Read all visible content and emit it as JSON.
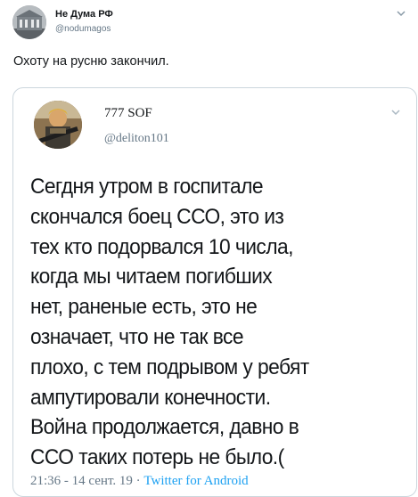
{
  "tweet": {
    "author_name": "Не Дума РФ",
    "author_handle": "@nodumagos",
    "text": "Охоту на русню закончил."
  },
  "quoted_tweet": {
    "author_name": "777 SOF",
    "author_handle": "@deliton101",
    "text_lines": [
      "Сегдня утром в госпитале",
      "скончался боец ССО, это из",
      "тех кто подорвался 10 числа,",
      "когда мы читаем погибших",
      "нет, раненые есть, это не",
      "означает, что не так все",
      "плохо, с тем подрывом у ребят",
      "ампутировали конечности.",
      "Война продолжается, давно в",
      "ССО таких потерь не было.("
    ],
    "meta_time": "21:36 - 14 сент. 19",
    "meta_separator": "·",
    "meta_source": "Twitter for Android"
  },
  "icons": {
    "caret": "chevron-down-icon",
    "avatar_outer": "building-avatar",
    "avatar_inner": "soldier-avatar"
  },
  "colors": {
    "text": "#14171a",
    "secondary": "#657786",
    "border": "#ccd6dd",
    "link": "#1da1f2"
  }
}
